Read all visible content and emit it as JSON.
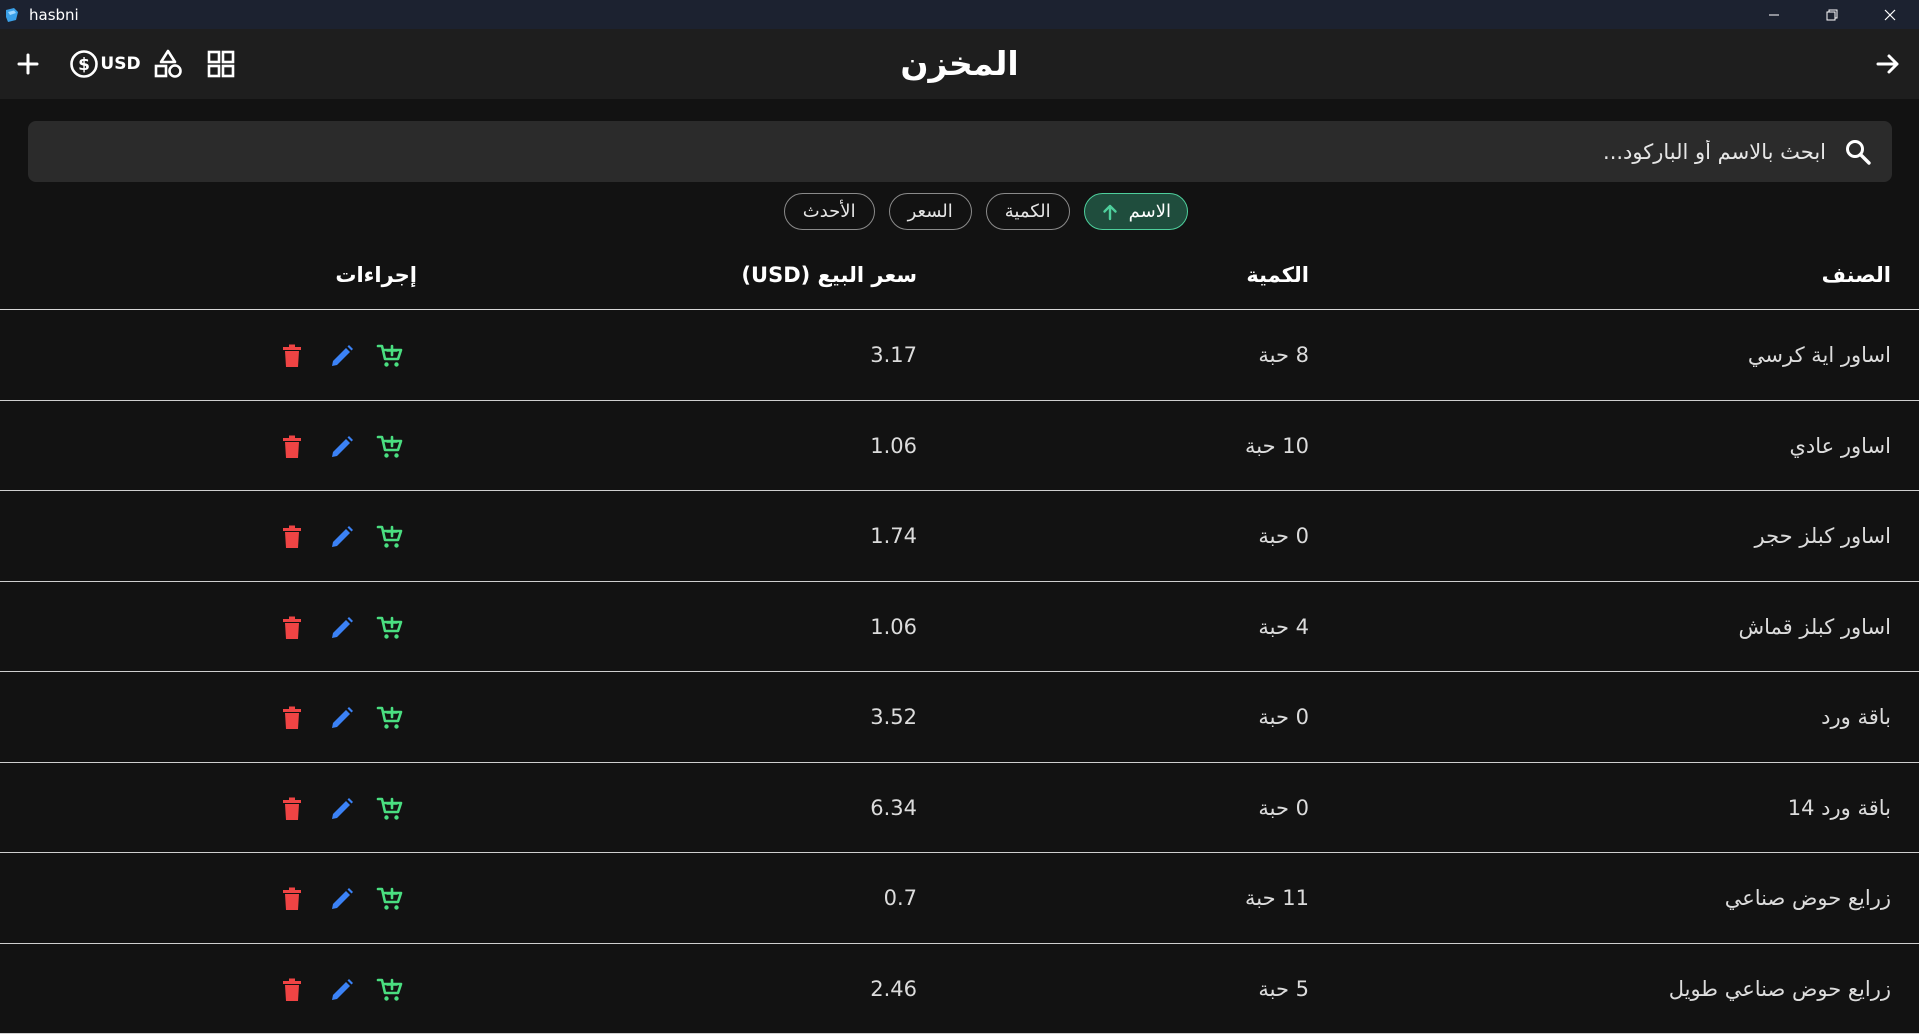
{
  "window": {
    "title": "hasbni"
  },
  "appbar": {
    "title": "المخزن",
    "currency": "USD"
  },
  "search": {
    "placeholder": "ابحث بالاسم أو الباركود..."
  },
  "sort_chips": [
    {
      "label": "الاسم",
      "active": true
    },
    {
      "label": "الكمية",
      "active": false
    },
    {
      "label": "السعر",
      "active": false
    },
    {
      "label": "الأحدث",
      "active": false
    }
  ],
  "table": {
    "headers": {
      "name": "الصنف",
      "quantity": "الكمية",
      "price": "سعر البيع (USD)",
      "actions": "إجراءات"
    },
    "rows": [
      {
        "name": "اساور اية كرسي",
        "quantity": "8 حبة",
        "price": "3.17"
      },
      {
        "name": "اساور عادي",
        "quantity": "10 حبة",
        "price": "1.06"
      },
      {
        "name": "اساور كبلز حجر",
        "quantity": "0 حبة",
        "price": "1.74"
      },
      {
        "name": "اساور كبلز قماش",
        "quantity": "4 حبة",
        "price": "1.06"
      },
      {
        "name": "باقة ورد",
        "quantity": "0 حبة",
        "price": "3.52"
      },
      {
        "name": "باقة ورد 14",
        "quantity": "0 حبة",
        "price": "6.34"
      },
      {
        "name": "زرايع حوض صناعي",
        "quantity": "11 حبة",
        "price": "0.7"
      },
      {
        "name": "زرايع حوض صناعي طويل",
        "quantity": "5 حبة",
        "price": "2.46"
      }
    ]
  },
  "colors": {
    "cart": "#4ade80",
    "edit": "#3b82f6",
    "delete": "#ef4444",
    "active_chip_border": "#4ecf9c"
  }
}
